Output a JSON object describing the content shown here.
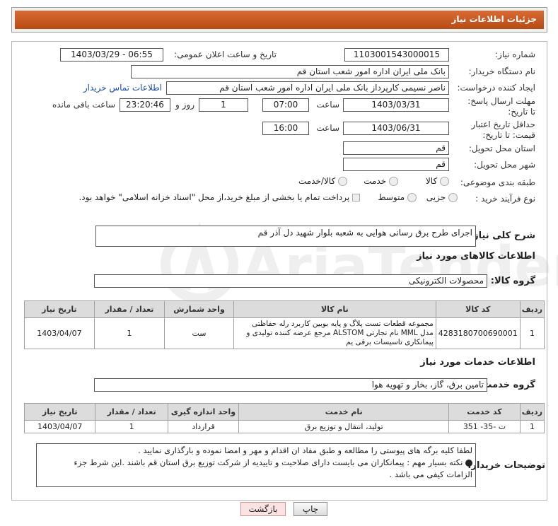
{
  "header": {
    "title": "جزئیات اطلاعات نیاز"
  },
  "fields": {
    "need_number_label": "شماره نیاز:",
    "need_number": "1103001543000015",
    "announce_label": "تاریخ و ساعت اعلان عمومی:",
    "announce_value": "1403/03/29 - 06:55",
    "buyer_org_label": "نام دستگاه خریدار:",
    "buyer_org": "بانک ملی ایران اداره امور شعب استان قم",
    "creator_label": "ایجاد کننده درخواست:",
    "creator": "ناصر  نسیمی  کارپرداز  بانک ملی ایران اداره امور شعب استان قم",
    "contact_link": "اطلاعات تماس خریدار",
    "reply_deadline_label": "مهلت ارسال پاسخ: تا تاریخ:",
    "reply_date": "1403/03/31",
    "time_label": "ساعت",
    "reply_time": "07:00",
    "days_value": "1",
    "days_label": "روز و",
    "remaining_time": "23:20:46",
    "remaining_label": "ساعت باقی مانده",
    "validity_label": "حداقل تاریخ اعتبار قیمت: تا تاریخ:",
    "validity_date": "1403/06/31",
    "validity_time": "16:00",
    "province_label": "استان محل تحویل:",
    "province": "قم",
    "city_label": "شهر محل تحویل:",
    "city": "قم",
    "category_label": "طبقه بندی موضوعی:",
    "category_options": [
      "کالا",
      "خدمت",
      "کالا/خدمت"
    ],
    "process_label": "نوع فرآیند خرید :",
    "process_options": [
      "جزیی",
      "متوسط"
    ],
    "payment_note": "پرداخت تمام یا بخشی از مبلغ خرید،از محل \"اسناد خزانه اسلامی\" خواهد بود."
  },
  "description": {
    "label": "شرح کلی نیاز:",
    "text": "اجرای طرح برق رسانی هوایی به شعبه بلوار شهید دل آذر قم"
  },
  "goods": {
    "section_title": "اطلاعات کالاهای مورد نیاز",
    "group_label": "گروه کالا:",
    "group_value": "محصولات الکترونیکی",
    "columns": [
      "ردیف",
      "کد کالا",
      "نام کالا",
      "واحد شمارش",
      "تعداد / مقدار",
      "تاریخ نیاز"
    ],
    "rows": [
      [
        "1",
        "4283180700690001",
        "مجموعه قطعات تست پلاگ و پایه بوبین کاربرد رله حفاظتی مدل MML نام تجارتی ALSTOM مرجع عرضه کننده تولیدی و پیمانکاری تاسیسات برقی یم",
        "ست",
        "1",
        "1403/04/07"
      ]
    ]
  },
  "services": {
    "section_title": "اطلاعات خدمات مورد نیاز",
    "group_label": "گروه خدمت:",
    "group_value": "تامین برق، گاز، بخار و تهویه هوا",
    "columns": [
      "ردیف",
      "کد خدمت",
      "نام خدمت",
      "واحد اندازه گیری",
      "تعداد / مقدار",
      "تاریخ نیاز"
    ],
    "rows": [
      [
        "1",
        "ت -35- 351",
        "تولید، انتقال و توزیع برق",
        "قرارداد",
        "1",
        "1403/04/07"
      ]
    ]
  },
  "buyer_notes": {
    "label": "توضیحات خریدار:",
    "line1": "لطفا کلیه برگه های پیوستی را مطالعه و طبق مفاد ان اقدام و مهر و امضا نموده و بارگذاری نمایید .",
    "line2": "نکته بسیار مهم : پیمانکاران می بایست دارای صلاحیت و تاییدیه از شرکت توزیع برق استان قم باشند .این شرط جزء",
    "line3": "الزامات کیفی می باشد ."
  },
  "buttons": {
    "print": "چاپ",
    "back": "بازگشت"
  },
  "watermark": {
    "text": "AriaTender.neT"
  },
  "colors": {
    "header": "#c85a24",
    "link": "#1b4aa8",
    "back_button_bg": "#fbe3e3"
  }
}
